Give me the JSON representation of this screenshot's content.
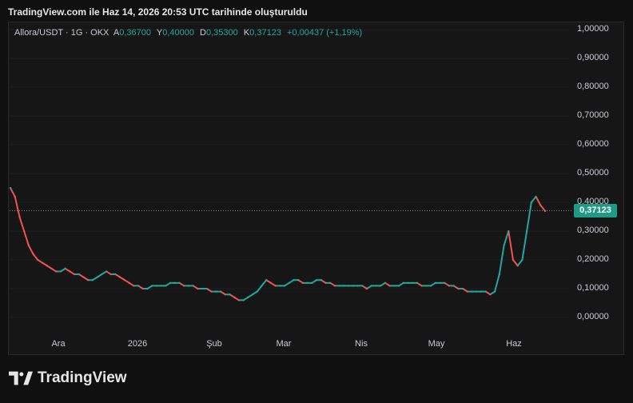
{
  "caption": "TradingView.com ile Haz 14, 2026 20:53 UTC tarihinde oluşturuldu",
  "legend": {
    "symbol": "Allora/USDT · 1G · OKX",
    "open_label": "A",
    "open": "0,36700",
    "high_label": "Y",
    "high": "0,40000",
    "low_label": "D",
    "low": "0,35300",
    "close_label": "K",
    "close": "0,37123",
    "change": "+0,00437 (+1,19%)"
  },
  "last_price": "0,37123",
  "brand": {
    "name": "TradingView",
    "logo_icon": "tradingview-logo-icon"
  },
  "colors": {
    "up": "#26a69a",
    "down": "#ef5350",
    "background": "#161616",
    "tag": "#1e9a86"
  },
  "chart_data": {
    "type": "line",
    "title": "Allora/USDT · 1G · OKX",
    "y_ticks": [
      "1,00000",
      "0,90000",
      "0,80000",
      "0,70000",
      "0,60000",
      "0,50000",
      "0,40000",
      "0,30000",
      "0,20000",
      "0,10000",
      "0,00000"
    ],
    "y_tick_values": [
      1.0,
      0.9,
      0.8,
      0.7,
      0.6,
      0.5,
      0.4,
      0.3,
      0.2,
      0.1,
      0.0
    ],
    "x_ticks": [
      "Ara",
      "2026",
      "Şub",
      "Mar",
      "Nis",
      "May",
      "Haz"
    ],
    "ylim": [
      -0.05,
      1.02
    ],
    "last_price": 0.37123,
    "series": [
      {
        "values": [
          0.45,
          0.42,
          0.35,
          0.3,
          0.25,
          0.22,
          0.2,
          0.19,
          0.18,
          0.17,
          0.16,
          0.16,
          0.17,
          0.16,
          0.15,
          0.15,
          0.14,
          0.13,
          0.13,
          0.14,
          0.15,
          0.16,
          0.15,
          0.15,
          0.14,
          0.13,
          0.12,
          0.11,
          0.11,
          0.1,
          0.1,
          0.11,
          0.11,
          0.11,
          0.11,
          0.12,
          0.12,
          0.12,
          0.11,
          0.11,
          0.11,
          0.1,
          0.1,
          0.1,
          0.09,
          0.09,
          0.09,
          0.08,
          0.08,
          0.07,
          0.06,
          0.06,
          0.07,
          0.08,
          0.09,
          0.11,
          0.13,
          0.12,
          0.11,
          0.11,
          0.11,
          0.12,
          0.13,
          0.13,
          0.12,
          0.12,
          0.12,
          0.13,
          0.13,
          0.12,
          0.12,
          0.11,
          0.11,
          0.11,
          0.11,
          0.11,
          0.11,
          0.11,
          0.1,
          0.11,
          0.11,
          0.11,
          0.12,
          0.11,
          0.11,
          0.11,
          0.12,
          0.12,
          0.12,
          0.12,
          0.11,
          0.11,
          0.11,
          0.12,
          0.12,
          0.12,
          0.11,
          0.11,
          0.1,
          0.1,
          0.09,
          0.09,
          0.09,
          0.09,
          0.09,
          0.08,
          0.09,
          0.15,
          0.25,
          0.3,
          0.2,
          0.18,
          0.2,
          0.3,
          0.4,
          0.42,
          0.39,
          0.37
        ]
      }
    ]
  }
}
